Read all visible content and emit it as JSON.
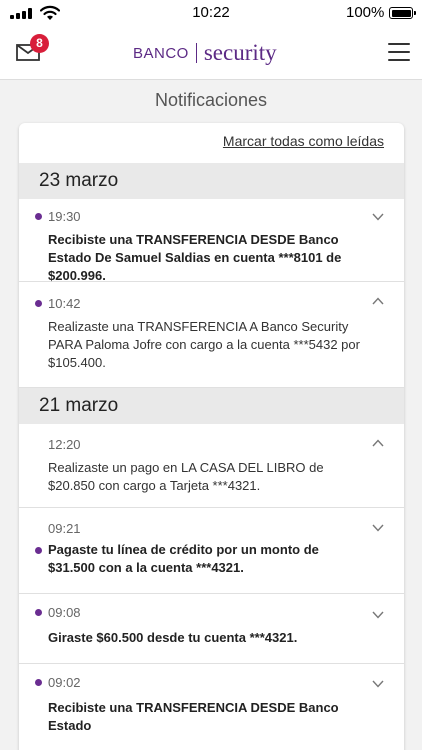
{
  "status_bar": {
    "time": "10:22",
    "battery": "100%"
  },
  "header": {
    "mail_badge": "8",
    "logo_banco": "BANCO",
    "logo_security": "security"
  },
  "page": {
    "title": "Notificaciones",
    "mark_all": "Marcar todas como leídas"
  },
  "groups": [
    {
      "date": "23 marzo",
      "items": [
        {
          "time": "19:30",
          "unread": true,
          "expanded": false,
          "text": "Recibiste una TRANSFERENCIA DESDE Banco Estado De Samuel Saldias en cuenta ***8101 de $200.996."
        },
        {
          "time": "10:42",
          "unread": true,
          "expanded": true,
          "text": "Realizaste una TRANSFERENCIA A Banco Security PARA Paloma Jofre con cargo a la cuenta ***5432 por $105.400."
        }
      ]
    },
    {
      "date": "21 marzo",
      "items": [
        {
          "time": "12:20",
          "unread": false,
          "expanded": true,
          "text": "Realizaste un pago en LA CASA DEL LIBRO de $20.850 con cargo a Tarjeta ***4321."
        },
        {
          "time": "09:21",
          "unread": true,
          "expanded": false,
          "text": "Pagaste tu línea de crédito por un monto de $31.500 con a la cuenta ***4321."
        },
        {
          "time": "09:08",
          "unread": true,
          "expanded": false,
          "text": "Giraste $60.500 desde tu cuenta ***4321."
        },
        {
          "time": "09:02",
          "unread": true,
          "expanded": false,
          "text": "Recibiste una TRANSFERENCIA DESDE Banco Estado"
        }
      ]
    }
  ]
}
